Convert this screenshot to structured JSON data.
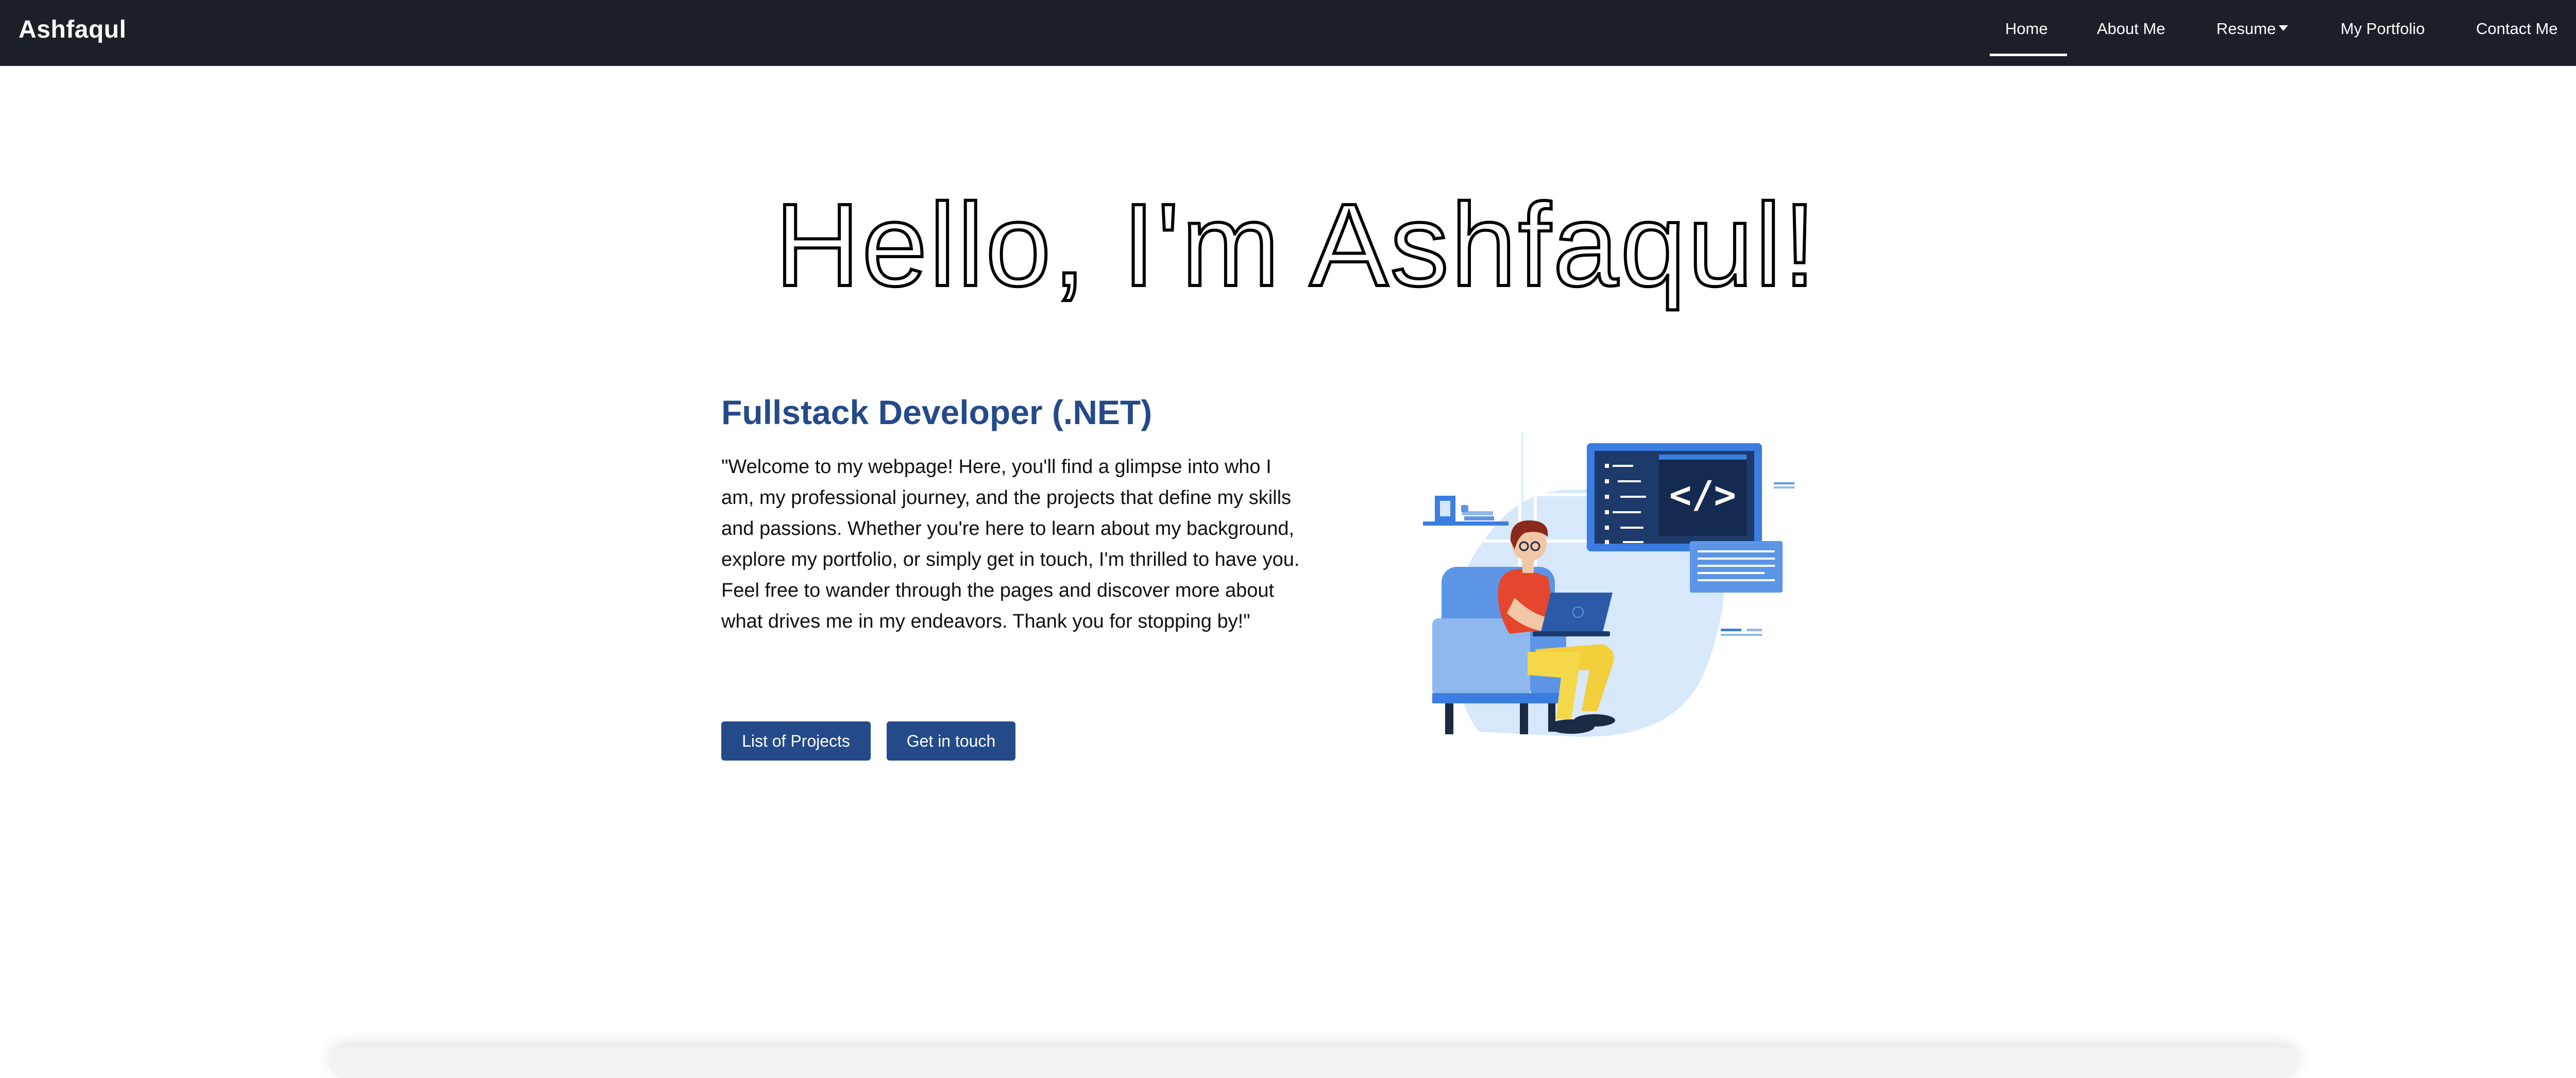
{
  "brand": "Ashfaqul",
  "nav": {
    "home": "Home",
    "about": "About Me",
    "resume": "Resume",
    "portfolio": "My Portfolio",
    "contact": "Contact Me"
  },
  "hero": {
    "title": "Hello, I'm Ashfaqul!",
    "role": "Fullstack Developer (.NET)",
    "intro": "\"Welcome to my webpage! Here, you'll find a glimpse into who I am, my professional journey, and the projects that define my skills and passions. Whether you're here to learn about my background, explore my portfolio, or simply get in touch, I'm thrilled to have you. Feel free to wander through the pages and discover more about what drives me in my endeavors. Thank you for stopping by!\"",
    "code_symbol": "</>"
  },
  "buttons": {
    "projects": "List of Projects",
    "contact": "Get in touch"
  },
  "colors": {
    "navbar_bg": "#1b1f27",
    "accent": "#254a8a",
    "illustration_blue": "#3b7de0"
  },
  "icons": {
    "resume_dropdown": "caret-down-icon"
  }
}
